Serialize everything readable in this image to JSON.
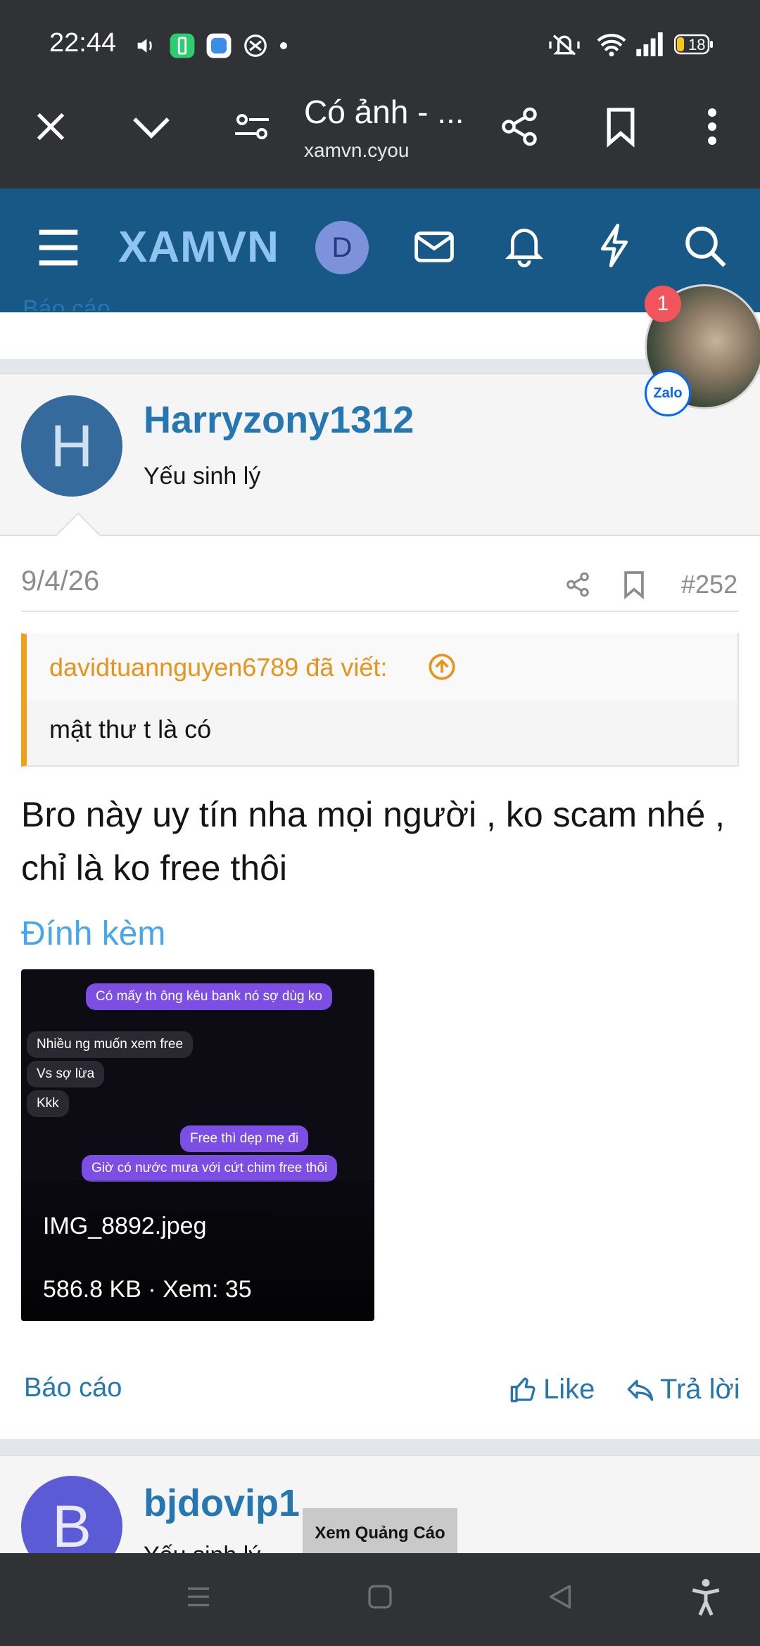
{
  "status_bar": {
    "time": "22:44",
    "battery": "18",
    "icons": [
      "volume-icon",
      "battery-saver-app-icon",
      "app-icon",
      "vpn-icon",
      "dot-icon",
      "mute-icon",
      "wifi-icon",
      "signal-icon",
      "battery-icon"
    ]
  },
  "browser": {
    "tab_title": "Có ảnh - ...",
    "domain": "xamvn.cyou",
    "icons": [
      "close-icon",
      "chevron-down-icon",
      "page-settings-icon",
      "share-icon",
      "bookmark-icon",
      "more-icon"
    ]
  },
  "site_header": {
    "logo": "XAMVN",
    "avatar_letter": "D",
    "icons": [
      "menu-icon",
      "mail-icon",
      "bell-icon",
      "lightning-icon",
      "search-icon"
    ]
  },
  "previous_post": {
    "report_label": "Báo cáo"
  },
  "post": {
    "avatar_letter": "H",
    "username": "Harryzony1312",
    "user_title": "Yếu sinh lý",
    "date": "9/4/26",
    "number": "#252",
    "quote": {
      "author_line": "davidtuannguyen6789 đã viết:",
      "text": "mật thư t là có"
    },
    "body": "Bro này uy tín nha mọi người , ko scam nhé , chỉ là ko free thôi",
    "attachments_label": "Đính kèm",
    "attachment": {
      "filename": "IMG_8892.jpeg",
      "meta": "586.8 KB · Xem: 35",
      "chat_lines": [
        {
          "text": "Có mấy th ông kêu bank nó sợ dùg ko",
          "side": "out"
        },
        {
          "text": "Nhiều ng muốn xem free",
          "side": "in"
        },
        {
          "text": "Vs sợ lừa",
          "side": "in"
        },
        {
          "text": "Kkk",
          "side": "in"
        },
        {
          "text": "Free thì dẹp mẹ đi",
          "side": "out"
        },
        {
          "text": "Giờ có nước mưa với cứt chim free thôi",
          "side": "out"
        }
      ]
    },
    "actions": {
      "report": "Báo cáo",
      "like": "Like",
      "reply": "Trả lời"
    }
  },
  "next_post": {
    "avatar_letter": "B",
    "username": "bjdovip1",
    "user_title": "Yếu sinh lý",
    "ad_label": "Xem Quảng Cáo"
  },
  "floating": {
    "badge_count": "1",
    "app_label": "Zalo"
  },
  "colors": {
    "site_header": "#185886",
    "link": "#2577b1",
    "quote_accent": "#f0a216",
    "attachment_heading": "#47a7eb"
  }
}
